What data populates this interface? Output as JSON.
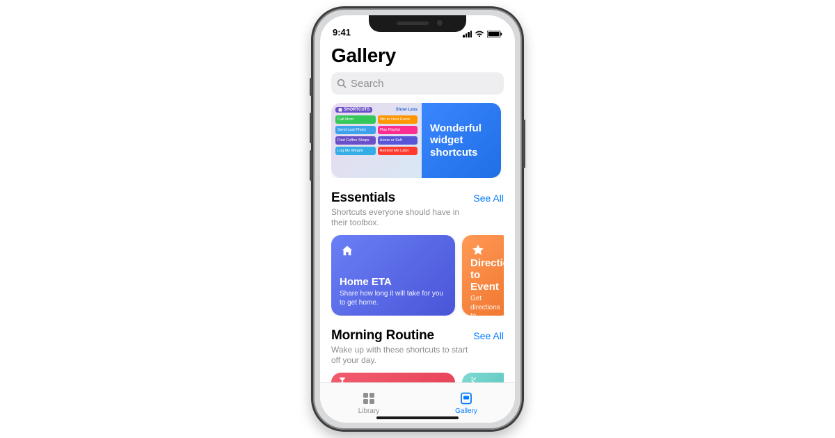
{
  "status": {
    "time": "9:41"
  },
  "page": {
    "title": "Gallery"
  },
  "search": {
    "placeholder": "Search"
  },
  "featured": {
    "badge": "SHORTCUTS",
    "show_less": "Show Less",
    "widgets": [
      {
        "label": "Call Mom",
        "cls": "wp-green"
      },
      {
        "label": "Min to Next Event",
        "cls": "wp-orange"
      },
      {
        "label": "Send Last Photo",
        "cls": "wp-blue"
      },
      {
        "label": "Play Playlist",
        "cls": "wp-pink"
      },
      {
        "label": "Find Coffee Shops",
        "cls": "wp-purple"
      },
      {
        "label": "Home or Self",
        "cls": "wp-indigo"
      },
      {
        "label": "Log My Weight",
        "cls": "wp-teal"
      },
      {
        "label": "Remind Me Later",
        "cls": "wp-red"
      }
    ],
    "headline": "Wonderful widget shortcuts"
  },
  "sections": [
    {
      "title": "Essentials",
      "see_all": "See All",
      "subtitle": "Shortcuts everyone should have in their toolbox.",
      "cards": [
        {
          "title": "Home ETA",
          "desc": "Share how long it will take for you to get home."
        },
        {
          "title": "Directions to Event",
          "desc": "Get directions to calendar event."
        }
      ]
    },
    {
      "title": "Morning Routine",
      "see_all": "See All",
      "subtitle": "Wake up with these shortcuts to start off your day."
    }
  ],
  "tabs": {
    "library": "Library",
    "gallery": "Gallery"
  }
}
